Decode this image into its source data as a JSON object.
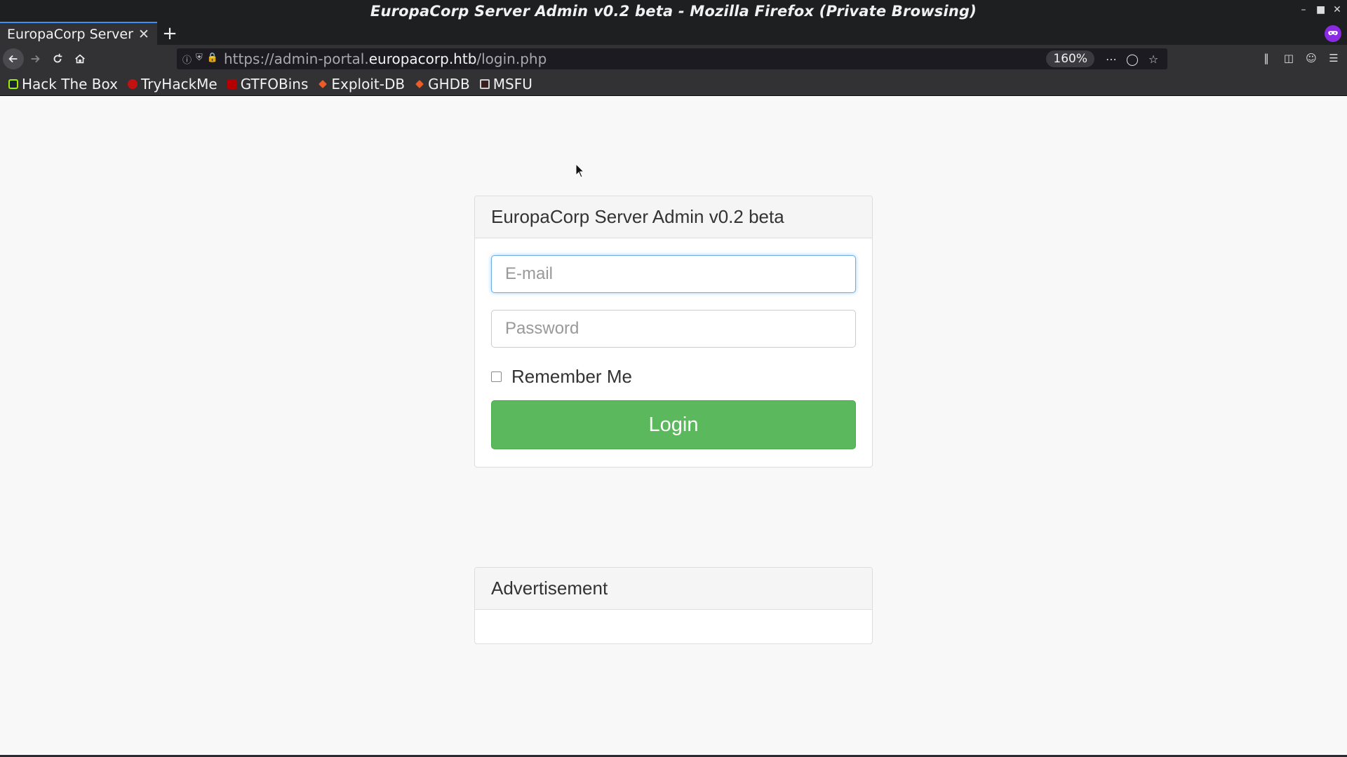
{
  "window": {
    "title": "EuropaCorp Server Admin v0.2 beta - Mozilla Firefox (Private Browsing)"
  },
  "tabs": [
    {
      "label": "EuropaCorp Server",
      "active": true
    }
  ],
  "navigation": {
    "url_prefix": "https://admin-portal.",
    "url_domain": "europacorp.htb",
    "url_path": "/login.php",
    "zoom": "160%"
  },
  "bookmarks": [
    {
      "label": "Hack The Box",
      "icon": "htb-icon",
      "color": "#9fef00"
    },
    {
      "label": "TryHackMe",
      "icon": "thm-icon",
      "color": "#c11111"
    },
    {
      "label": "GTFOBins",
      "icon": "gtfobins-icon",
      "color": "#b40000"
    },
    {
      "label": "Exploit-DB",
      "icon": "exploitdb-icon",
      "color": "#ec5b28"
    },
    {
      "label": "GHDB",
      "icon": "ghdb-icon",
      "color": "#ec5b28"
    },
    {
      "label": "MSFU",
      "icon": "msfu-icon",
      "color": "#cfcfcf"
    }
  ],
  "login": {
    "heading": "EuropaCorp Server Admin v0.2 beta",
    "email_placeholder": "E-mail",
    "password_placeholder": "Password",
    "remember_label": "Remember Me",
    "submit_label": "Login"
  },
  "advertisement": {
    "heading": "Advertisement"
  },
  "colors": {
    "accent_blue": "#3d8ef7",
    "login_green": "#5cb85c",
    "private_purple": "#8a2be2"
  }
}
